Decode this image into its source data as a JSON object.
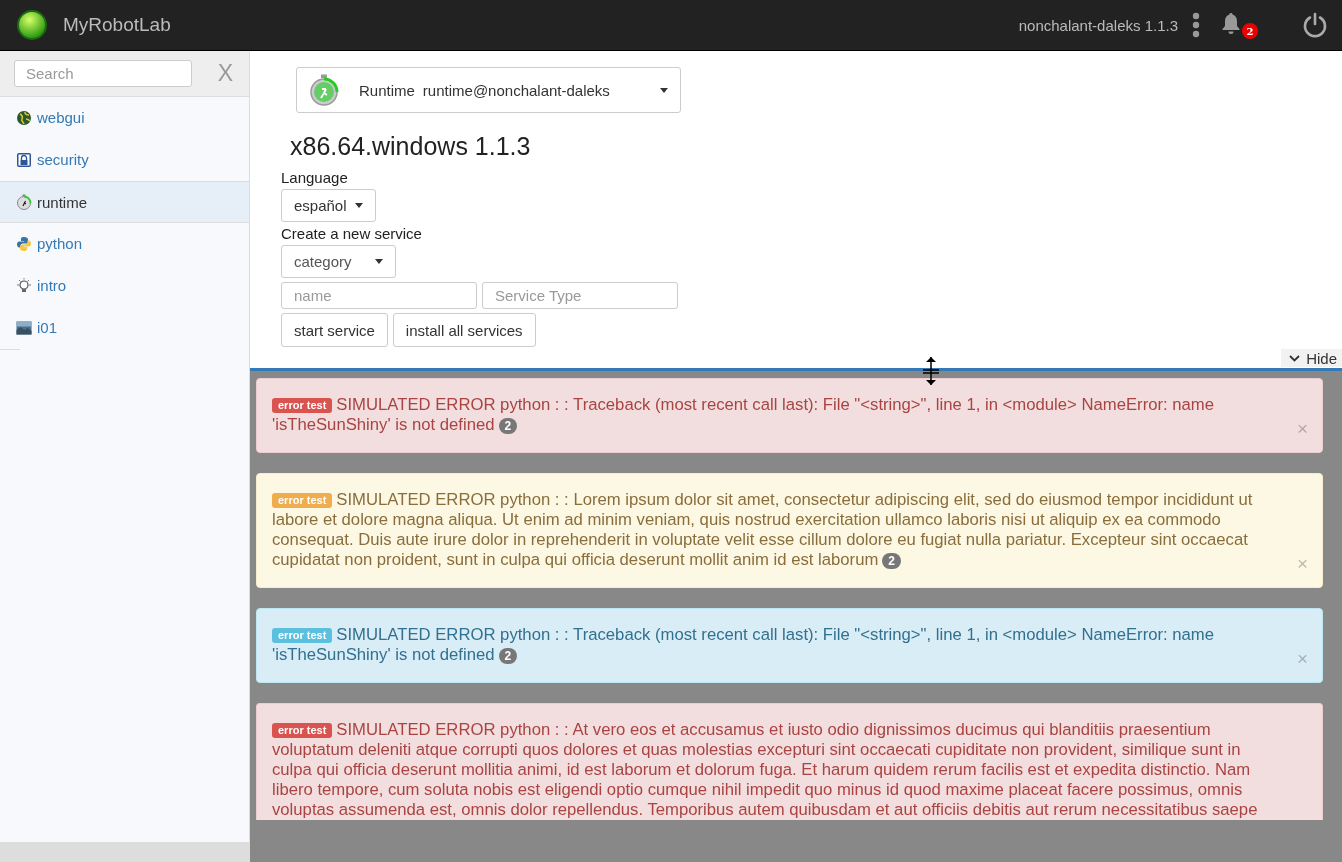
{
  "navbar": {
    "brand": "MyRobotLab",
    "instance": "nonchalant-daleks 1.1.3",
    "notification_count": "2"
  },
  "sidebar": {
    "search": {
      "placeholder": "Search"
    },
    "clear": "X",
    "items": [
      {
        "label": "webgui",
        "selected": false
      },
      {
        "label": "security",
        "selected": false
      },
      {
        "label": "runtime",
        "selected": true
      },
      {
        "label": "python",
        "selected": false
      },
      {
        "label": "intro",
        "selected": false
      },
      {
        "label": "i01",
        "selected": false
      }
    ]
  },
  "service_header": {
    "type": "Runtime",
    "name": "runtime@nonchalant-daleks"
  },
  "platform": "x86.64.windows 1.1.3",
  "language": {
    "label": "Language",
    "value": "español"
  },
  "create_service": {
    "label": "Create a new service",
    "category": "category",
    "name_placeholder": "name",
    "type_placeholder": "Service Type",
    "buttons": [
      "start service",
      "install all services"
    ]
  },
  "hide_button": "Hide",
  "alerts": [
    {
      "kind": "danger",
      "tag": "error test",
      "text": "SIMULATED ERROR python : : Traceback (most recent call last): File \"<string>\", line 1, in <module> NameError: name 'isTheSunShiny' is not defined",
      "count": "2",
      "close": "×",
      "cut": false
    },
    {
      "kind": "warning",
      "tag": "error test",
      "text": "SIMULATED ERROR python : : Lorem ipsum dolor sit amet, consectetur adipiscing elit, sed do eiusmod tempor incididunt ut labore et dolore magna aliqua. Ut enim ad minim veniam, quis nostrud exercitation ullamco laboris nisi ut aliquip ex ea commodo consequat. Duis aute irure dolor in reprehenderit in voluptate velit esse cillum dolore eu fugiat nulla pariatur. Excepteur sint occaecat cupidatat non proident, sunt in culpa qui officia deserunt mollit anim id est laborum",
      "count": "2",
      "close": "×",
      "cut": false
    },
    {
      "kind": "info",
      "tag": "error test",
      "text": "SIMULATED ERROR python : : Traceback (most recent call last): File \"<string>\", line 1, in <module> NameError: name 'isTheSunShiny' is not defined",
      "count": "2",
      "close": "×",
      "cut": false
    },
    {
      "kind": "danger",
      "tag": "error test",
      "text": "SIMULATED ERROR python : : At vero eos et accusamus et iusto odio dignissimos ducimus qui blanditiis praesentium voluptatum deleniti atque corrupti quos dolores et quas molestias excepturi sint occaecati cupiditate non provident, similique sunt in culpa qui officia deserunt mollitia animi, id est laborum et dolorum fuga. Et harum quidem rerum facilis est et expedita distinctio. Nam libero tempore, cum soluta nobis est eligendi optio cumque nihil impedit quo minus id quod maxime placeat facere possimus, omnis voluptas assumenda est, omnis dolor repellendus. Temporibus autem quibusdam et aut officiis debitis aut rerum necessitatibus saepe",
      "cut": true
    }
  ]
}
